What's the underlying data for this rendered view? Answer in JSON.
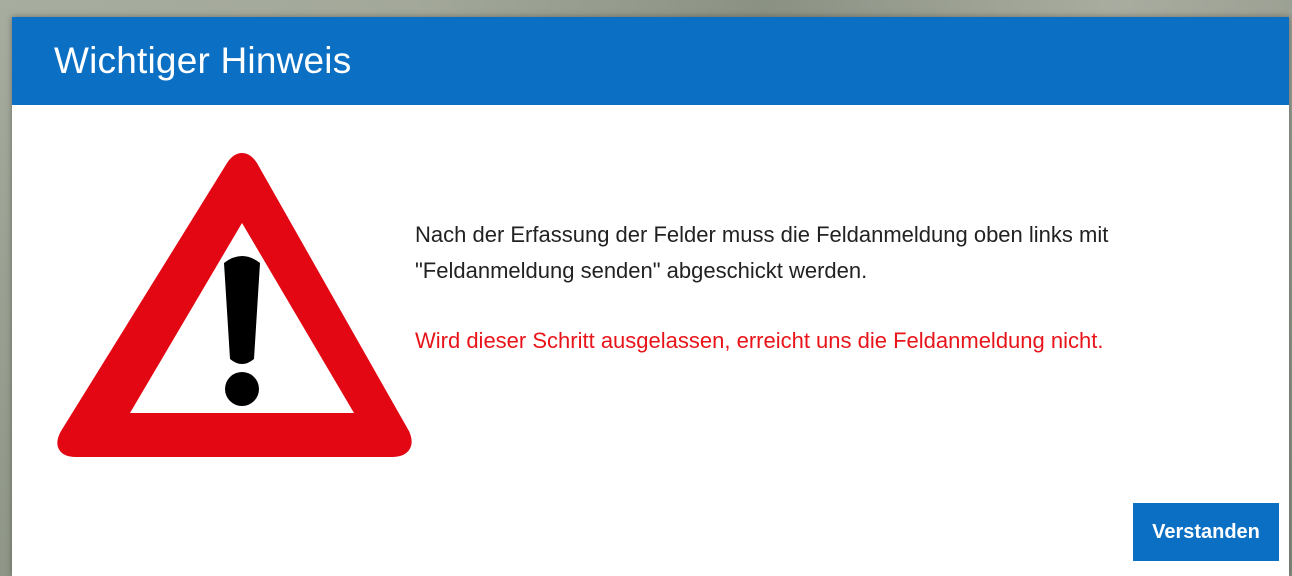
{
  "dialog": {
    "title": "Wichtiger Hinweis",
    "icon": "warning-triangle-exclamation-icon",
    "message": {
      "line1": "Nach der Erfassung der Felder muss die Feldanmeldung oben links mit",
      "line2": "\"Feldanmeldung senden\" abgeschickt werden.",
      "warning": "Wird dieser Schritt ausgelassen, erreicht uns die Feldanmeldung nicht."
    },
    "confirm_label": "Verstanden"
  },
  "colors": {
    "header_bg": "#0b6fc4",
    "button_bg": "#0b6fc4",
    "warning_text": "#e8141a",
    "sign_border": "#e30613",
    "body_text": "#222222"
  }
}
